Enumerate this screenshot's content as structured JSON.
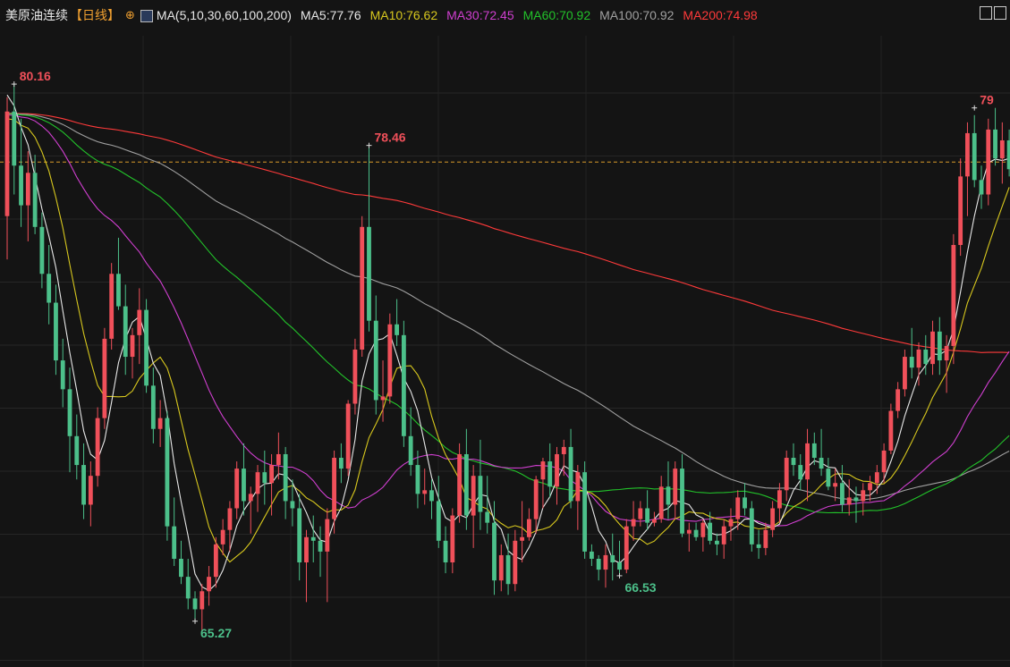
{
  "header": {
    "instrument": "美原油连续",
    "period": "【日线】",
    "settings_icon": "crosshair-icon",
    "chart_icon": "candlestick-chart-icon",
    "ma_config": "MA(5,10,30,60,100,200)",
    "ma_values": [
      {
        "label": "MA5:77.76",
        "color": "#e8e8e8"
      },
      {
        "label": "MA10:76.62",
        "color": "#d8c81e"
      },
      {
        "label": "MA30:72.45",
        "color": "#d03fd0"
      },
      {
        "label": "MA60:70.92",
        "color": "#22c22a"
      },
      {
        "label": "MA100:70.92",
        "color": "#a0a0a0"
      },
      {
        "label": "MA200:74.98",
        "color": "#ff3a3a"
      }
    ]
  },
  "chart_data": {
    "type": "candlestick",
    "grid": true,
    "up_color": "#f0505a",
    "down_color": "#4cc08a",
    "ylim": [
      64.0,
      81.5
    ],
    "reference_price": 78.0,
    "annotations": [
      {
        "text": "80.16",
        "index": 1,
        "value": 80.16,
        "kind": "high"
      },
      {
        "text": "78.46",
        "index": 52,
        "value": 78.46,
        "kind": "high"
      },
      {
        "text": "65.27",
        "index": 27,
        "value": 65.27,
        "kind": "low"
      },
      {
        "text": "66.53",
        "index": 88,
        "value": 66.53,
        "kind": "low"
      },
      {
        "text": "79",
        "index": 139,
        "value": 79.5,
        "kind": "high"
      }
    ],
    "ohlc": [
      [
        76.5,
        79.8,
        75.3,
        79.4
      ],
      [
        79.4,
        80.16,
        77.1,
        77.9
      ],
      [
        77.9,
        79.2,
        76.2,
        76.8
      ],
      [
        76.8,
        78.3,
        75.8,
        77.7
      ],
      [
        77.7,
        78.2,
        76.0,
        76.2
      ],
      [
        76.2,
        76.6,
        74.5,
        74.9
      ],
      [
        74.9,
        75.7,
        73.5,
        74.1
      ],
      [
        74.1,
        74.6,
        72.1,
        72.5
      ],
      [
        72.5,
        73.1,
        71.2,
        71.7
      ],
      [
        71.7,
        72.3,
        69.4,
        70.4
      ],
      [
        70.4,
        71.0,
        69.2,
        69.6
      ],
      [
        69.6,
        70.2,
        68.1,
        68.5
      ],
      [
        68.5,
        69.7,
        67.9,
        69.3
      ],
      [
        69.3,
        71.2,
        69.0,
        70.9
      ],
      [
        70.9,
        73.4,
        70.6,
        73.1
      ],
      [
        73.1,
        75.2,
        72.8,
        74.9
      ],
      [
        74.9,
        75.9,
        73.9,
        74.0
      ],
      [
        74.0,
        74.6,
        72.1,
        72.6
      ],
      [
        72.6,
        73.4,
        72.0,
        73.2
      ],
      [
        73.2,
        74.5,
        72.4,
        73.9
      ],
      [
        73.9,
        74.2,
        71.6,
        71.8
      ],
      [
        71.8,
        72.3,
        70.2,
        70.6
      ],
      [
        70.6,
        71.4,
        70.1,
        70.9
      ],
      [
        70.9,
        71.1,
        67.5,
        67.9
      ],
      [
        67.9,
        68.7,
        66.8,
        67.0
      ],
      [
        67.0,
        67.5,
        66.3,
        66.5
      ],
      [
        66.5,
        67.0,
        65.6,
        65.9
      ],
      [
        65.9,
        66.1,
        65.27,
        65.6
      ],
      [
        65.6,
        66.3,
        64.9,
        66.1
      ],
      [
        66.1,
        66.8,
        65.7,
        66.5
      ],
      [
        66.5,
        67.6,
        66.2,
        67.4
      ],
      [
        67.4,
        68.1,
        67.1,
        67.8
      ],
      [
        67.8,
        68.6,
        67.2,
        68.4
      ],
      [
        68.4,
        69.7,
        68.1,
        69.5
      ],
      [
        69.5,
        70.2,
        68.2,
        68.6
      ],
      [
        68.6,
        69.0,
        67.7,
        68.8
      ],
      [
        68.8,
        69.6,
        68.3,
        69.4
      ],
      [
        69.4,
        70.0,
        68.5,
        69.1
      ],
      [
        69.1,
        69.9,
        68.2,
        69.6
      ],
      [
        69.6,
        70.5,
        69.2,
        69.9
      ],
      [
        69.9,
        70.1,
        68.1,
        68.6
      ],
      [
        68.6,
        69.2,
        67.9,
        68.4
      ],
      [
        68.4,
        68.8,
        66.4,
        66.9
      ],
      [
        66.9,
        67.8,
        65.8,
        67.6
      ],
      [
        67.6,
        68.2,
        66.9,
        67.5
      ],
      [
        67.5,
        67.9,
        66.5,
        67.2
      ],
      [
        67.2,
        68.4,
        65.8,
        68.1
      ],
      [
        68.1,
        70.0,
        67.7,
        69.8
      ],
      [
        69.8,
        70.2,
        69.1,
        69.5
      ],
      [
        69.5,
        71.4,
        69.3,
        71.3
      ],
      [
        71.3,
        73.1,
        71.0,
        72.8
      ],
      [
        72.8,
        76.5,
        72.6,
        76.2
      ],
      [
        76.2,
        78.46,
        73.3,
        73.6
      ],
      [
        73.6,
        74.3,
        71.0,
        71.4
      ],
      [
        71.4,
        72.5,
        70.8,
        71.5
      ],
      [
        71.5,
        73.8,
        71.3,
        73.5
      ],
      [
        73.5,
        74.2,
        72.9,
        73.2
      ],
      [
        73.2,
        73.6,
        70.1,
        70.4
      ],
      [
        70.4,
        71.2,
        69.3,
        69.6
      ],
      [
        69.6,
        70.0,
        68.4,
        68.8
      ],
      [
        68.8,
        69.5,
        68.5,
        68.9
      ],
      [
        68.9,
        69.2,
        68.1,
        68.6
      ],
      [
        68.6,
        69.3,
        67.3,
        67.5
      ],
      [
        67.5,
        67.9,
        66.6,
        66.9
      ],
      [
        66.9,
        68.4,
        66.6,
        68.2
      ],
      [
        68.2,
        70.2,
        68.0,
        69.9
      ],
      [
        69.9,
        70.6,
        67.8,
        68.2
      ],
      [
        68.2,
        69.6,
        67.3,
        69.3
      ],
      [
        69.3,
        70.3,
        67.8,
        68.3
      ],
      [
        68.3,
        69.3,
        67.7,
        68.0
      ],
      [
        68.0,
        68.6,
        66.0,
        66.4
      ],
      [
        66.4,
        67.4,
        66.1,
        67.1
      ],
      [
        67.1,
        67.7,
        66.0,
        66.3
      ],
      [
        66.3,
        67.8,
        66.1,
        67.5
      ],
      [
        67.5,
        68.6,
        66.9,
        67.6
      ],
      [
        67.6,
        68.4,
        67.5,
        68.1
      ],
      [
        68.1,
        69.3,
        67.7,
        69.2
      ],
      [
        69.2,
        69.8,
        68.4,
        69.7
      ],
      [
        69.7,
        70.2,
        68.7,
        69.0
      ],
      [
        69.0,
        70.1,
        68.5,
        69.9
      ],
      [
        69.9,
        70.3,
        69.3,
        70.1
      ],
      [
        70.1,
        70.6,
        68.4,
        68.6
      ],
      [
        68.6,
        69.6,
        67.8,
        69.4
      ],
      [
        69.4,
        69.7,
        67.0,
        67.2
      ],
      [
        67.2,
        67.4,
        66.8,
        67.0
      ],
      [
        67.0,
        67.1,
        66.4,
        66.7
      ],
      [
        66.7,
        67.4,
        66.2,
        67.1
      ],
      [
        67.1,
        67.7,
        66.4,
        66.9
      ],
      [
        66.9,
        67.5,
        66.53,
        66.7
      ],
      [
        66.7,
        68.1,
        66.6,
        67.9
      ],
      [
        67.9,
        68.6,
        67.5,
        68.1
      ],
      [
        68.1,
        68.6,
        67.9,
        68.4
      ],
      [
        68.4,
        68.9,
        67.8,
        68.0
      ],
      [
        68.0,
        68.3,
        67.9,
        68.1
      ],
      [
        68.1,
        69.3,
        68.0,
        69.0
      ],
      [
        69.0,
        69.7,
        68.1,
        68.5
      ],
      [
        68.5,
        69.7,
        68.1,
        69.5
      ],
      [
        69.5,
        69.9,
        67.6,
        67.7
      ],
      [
        67.7,
        68.0,
        67.2,
        67.8
      ],
      [
        67.8,
        68.0,
        67.5,
        67.6
      ],
      [
        67.6,
        68.1,
        67.2,
        68.0
      ],
      [
        68.0,
        68.3,
        67.4,
        67.5
      ],
      [
        67.5,
        67.7,
        67.1,
        67.4
      ],
      [
        67.4,
        68.1,
        67.0,
        67.9
      ],
      [
        67.9,
        68.4,
        67.5,
        68.1
      ],
      [
        68.1,
        68.9,
        67.8,
        68.7
      ],
      [
        68.7,
        69.1,
        68.2,
        68.4
      ],
      [
        68.4,
        68.6,
        67.2,
        67.4
      ],
      [
        67.4,
        67.8,
        67.0,
        67.3
      ],
      [
        67.3,
        68.0,
        67.1,
        67.8
      ],
      [
        67.8,
        68.6,
        67.6,
        68.4
      ],
      [
        68.4,
        69.1,
        68.0,
        68.9
      ],
      [
        68.9,
        70.0,
        68.6,
        69.8
      ],
      [
        69.8,
        70.2,
        69.3,
        69.6
      ],
      [
        69.6,
        69.9,
        68.9,
        69.2
      ],
      [
        69.2,
        70.6,
        68.6,
        70.2
      ],
      [
        70.2,
        70.5,
        69.6,
        69.8
      ],
      [
        69.8,
        70.6,
        69.3,
        69.5
      ],
      [
        69.5,
        69.8,
        68.9,
        69.0
      ],
      [
        69.0,
        69.5,
        68.6,
        69.1
      ],
      [
        69.1,
        69.6,
        68.3,
        68.5
      ],
      [
        68.5,
        69.2,
        68.2,
        68.7
      ],
      [
        68.7,
        69.0,
        68.0,
        68.6
      ],
      [
        68.6,
        69.1,
        68.2,
        68.9
      ],
      [
        68.9,
        69.3,
        68.6,
        69.1
      ],
      [
        69.1,
        69.6,
        68.8,
        69.4
      ],
      [
        69.4,
        70.2,
        69.1,
        70.0
      ],
      [
        70.0,
        71.3,
        69.9,
        71.1
      ],
      [
        71.1,
        71.9,
        70.9,
        71.7
      ],
      [
        71.7,
        72.8,
        71.5,
        72.6
      ],
      [
        72.6,
        73.4,
        72.0,
        72.3
      ],
      [
        72.3,
        73.0,
        71.8,
        72.8
      ],
      [
        72.8,
        73.2,
        72.1,
        72.4
      ],
      [
        72.4,
        73.6,
        72.1,
        73.3
      ],
      [
        73.3,
        73.7,
        72.1,
        72.5
      ],
      [
        72.5,
        73.2,
        71.6,
        72.9
      ],
      [
        72.9,
        76.0,
        72.4,
        75.7
      ],
      [
        75.7,
        78.1,
        75.4,
        77.6
      ],
      [
        77.6,
        79.1,
        76.5,
        78.8
      ],
      [
        78.8,
        79.3,
        77.3,
        77.5
      ],
      [
        77.5,
        77.9,
        76.7,
        77.1
      ],
      [
        77.1,
        79.2,
        76.8,
        78.9
      ],
      [
        78.9,
        79.5,
        77.9,
        78.1
      ],
      [
        78.1,
        79.1,
        77.4,
        78.6
      ],
      [
        78.6,
        78.9,
        77.6,
        77.8
      ]
    ]
  }
}
